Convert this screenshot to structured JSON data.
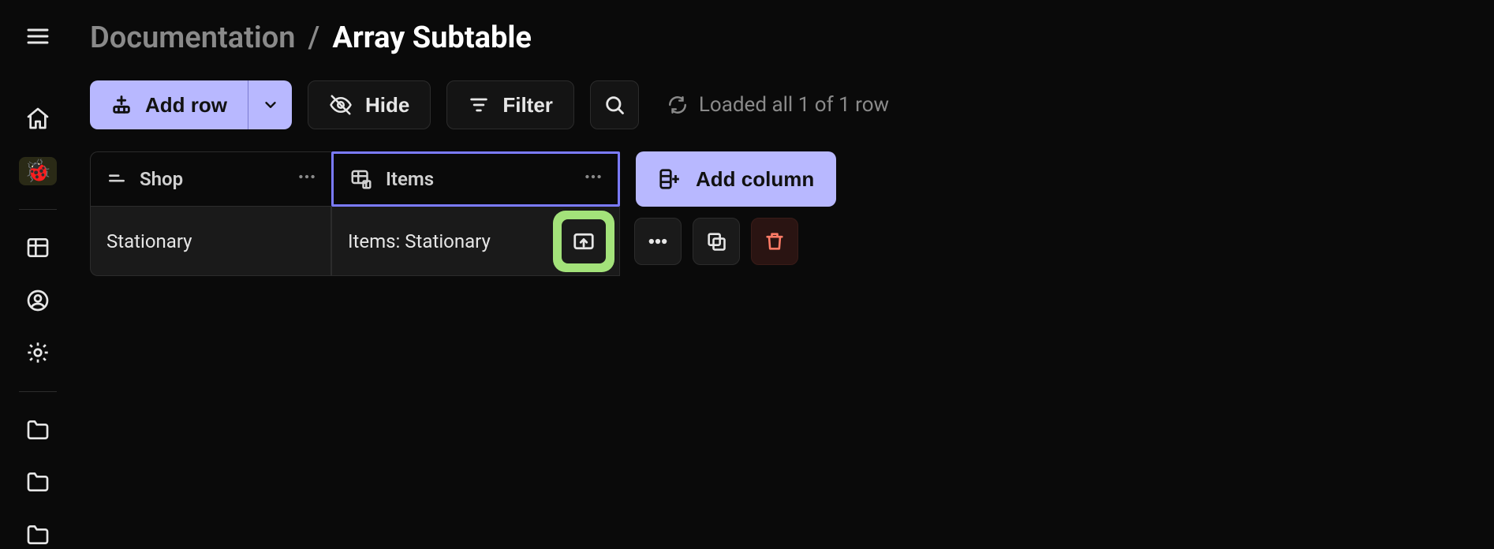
{
  "breadcrumb": {
    "root": "Documentation",
    "sep": "/",
    "leaf": "Array Subtable"
  },
  "toolbar": {
    "add_row": "Add row",
    "hide": "Hide",
    "filter": "Filter"
  },
  "status": {
    "text": "Loaded all 1 of 1 row"
  },
  "columns": {
    "shop": "Shop",
    "items": "Items",
    "add_column": "Add column"
  },
  "rows": [
    {
      "shop": "Stationary",
      "items": "Items: Stationary"
    }
  ]
}
